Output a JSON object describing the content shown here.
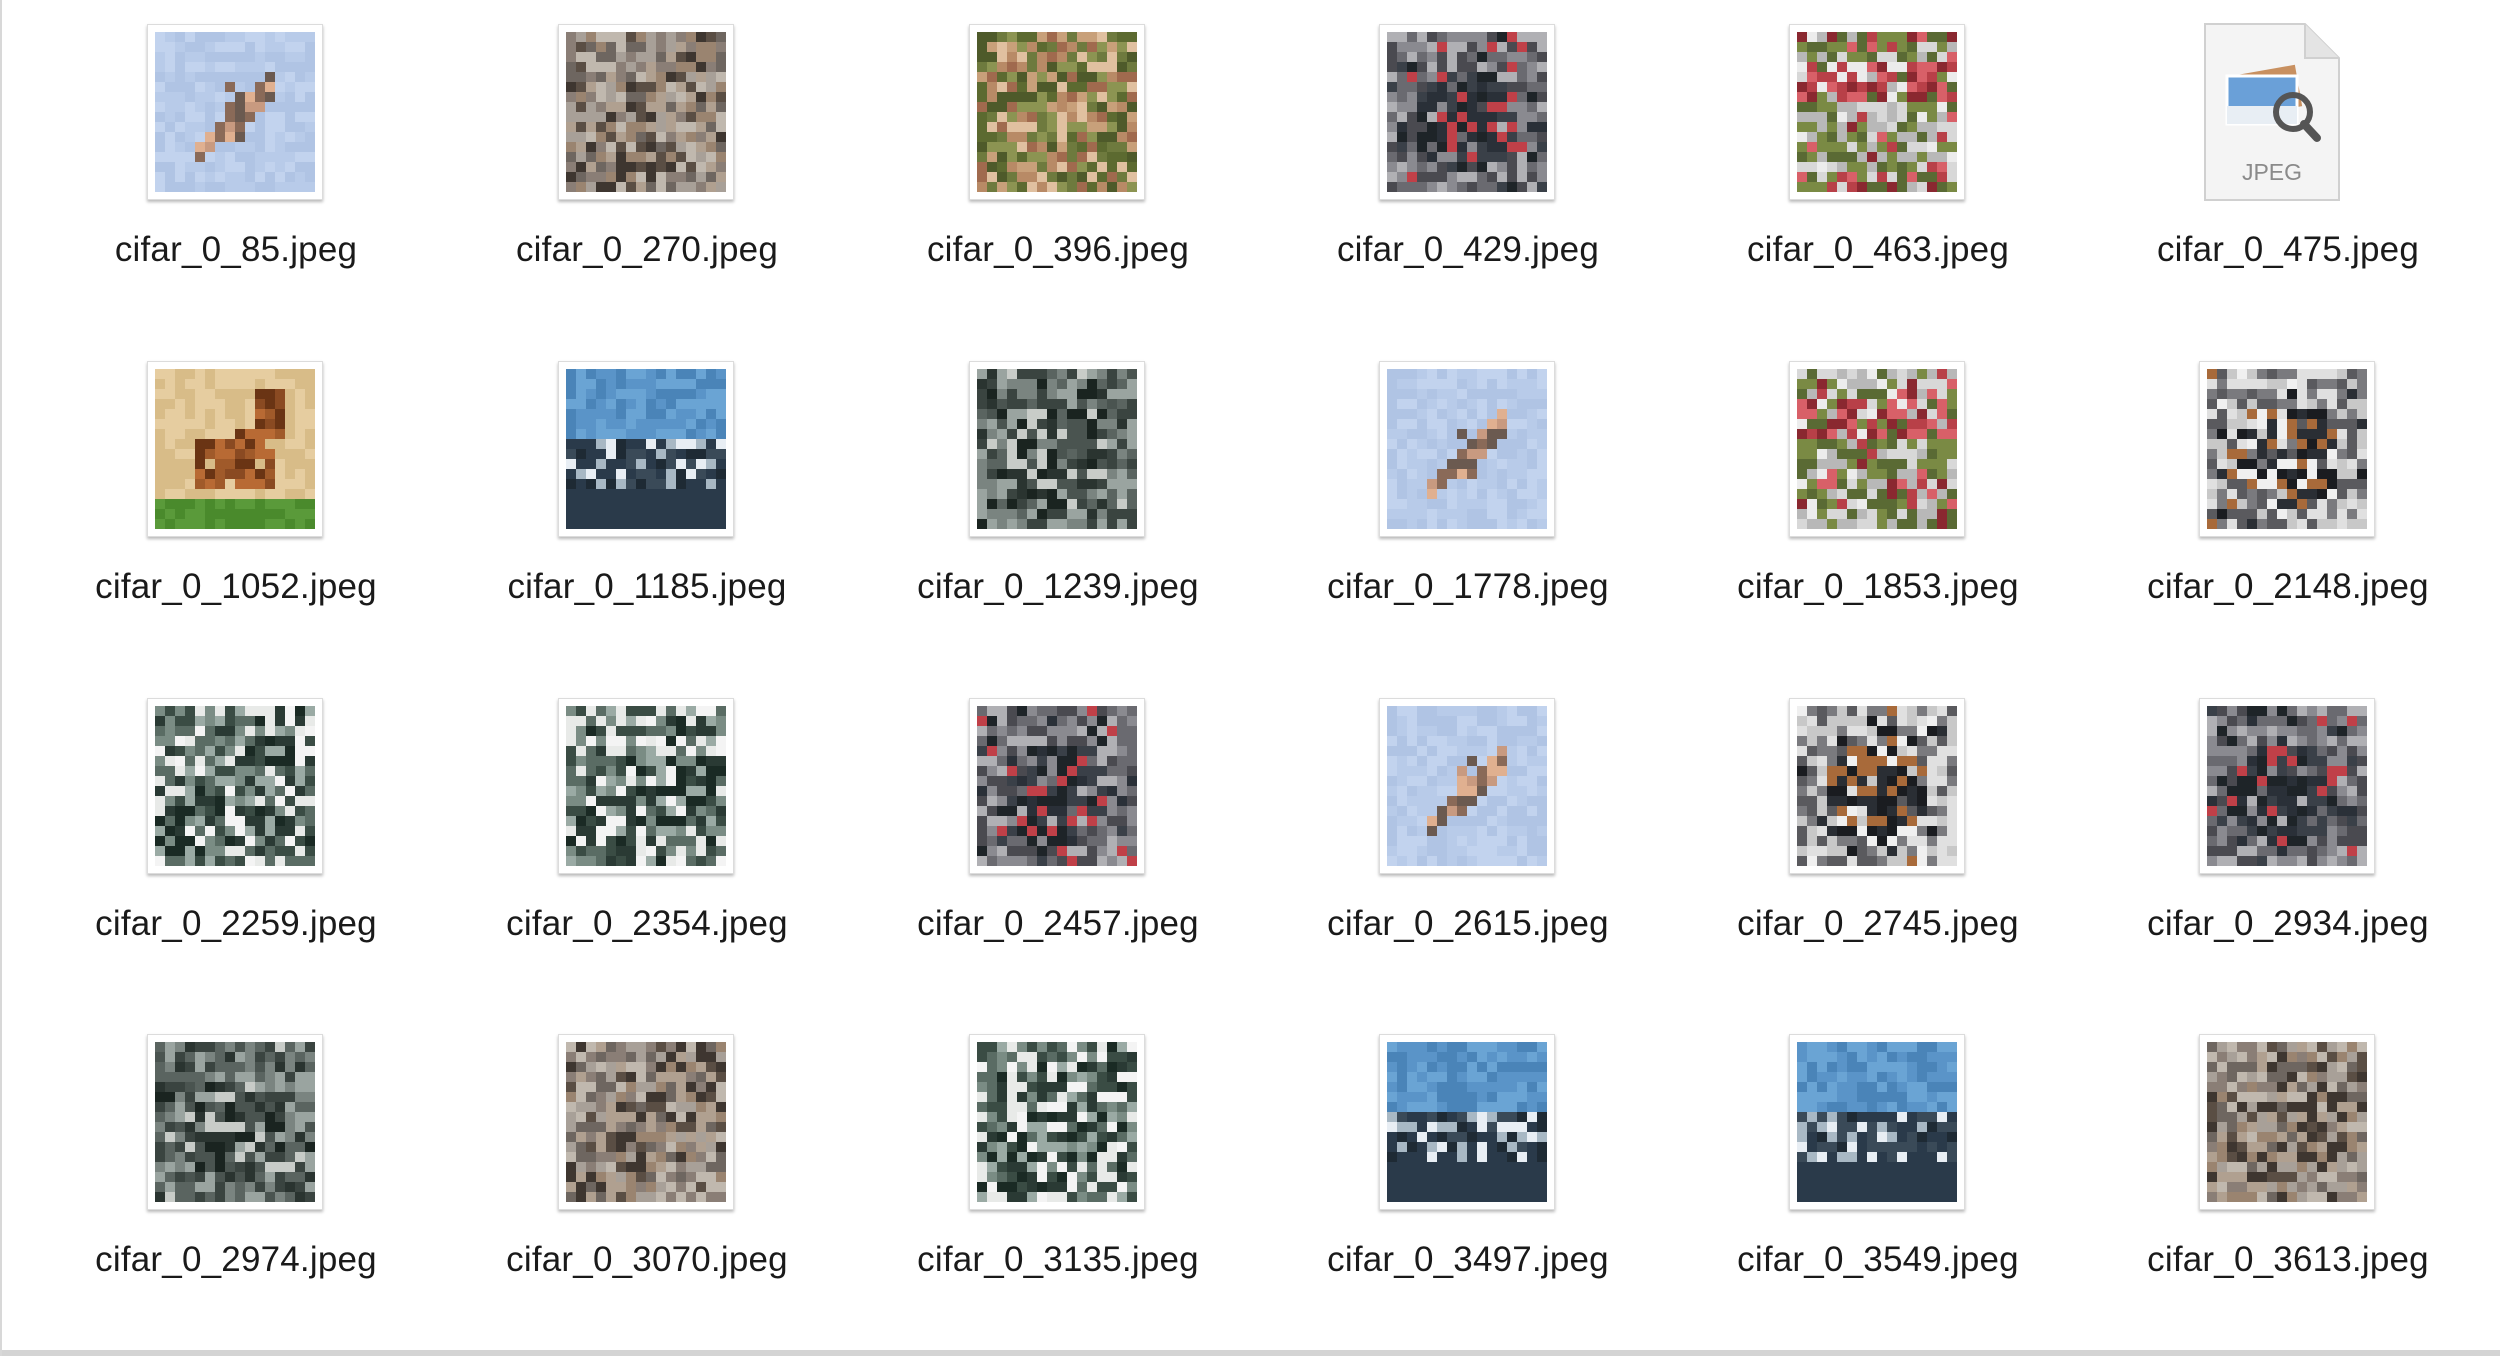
{
  "files": [
    {
      "name": "cifar_0_85.jpeg",
      "icon": "airplane-thumbnail"
    },
    {
      "name": "cifar_0_270.jpeg",
      "icon": "bird-thumbnail"
    },
    {
      "name": "cifar_0_396.jpeg",
      "icon": "foliage-thumbnail"
    },
    {
      "name": "cifar_0_429.jpeg",
      "icon": "vehicle-thumbnail"
    },
    {
      "name": "cifar_0_463.jpeg",
      "icon": "red-object-thumbnail"
    },
    {
      "name": "cifar_0_475.jpeg",
      "icon": "jpeg-document-icon",
      "icon_label": "JPEG"
    },
    {
      "name": "cifar_0_1052.jpeg",
      "icon": "horse-thumbnail"
    },
    {
      "name": "cifar_0_1185.jpeg",
      "icon": "ship-thumbnail"
    },
    {
      "name": "cifar_0_1239.jpeg",
      "icon": "truck-thumbnail"
    },
    {
      "name": "cifar_0_1778.jpeg",
      "icon": "airplane-thumbnail"
    },
    {
      "name": "cifar_0_1853.jpeg",
      "icon": "red-object-thumbnail"
    },
    {
      "name": "cifar_0_2148.jpeg",
      "icon": "car-thumbnail"
    },
    {
      "name": "cifar_0_2259.jpeg",
      "icon": "dark-object-thumbnail"
    },
    {
      "name": "cifar_0_2354.jpeg",
      "icon": "dark-object-thumbnail"
    },
    {
      "name": "cifar_0_2457.jpeg",
      "icon": "vehicle-thumbnail"
    },
    {
      "name": "cifar_0_2615.jpeg",
      "icon": "airplane-thumbnail"
    },
    {
      "name": "cifar_0_2745.jpeg",
      "icon": "car-thumbnail"
    },
    {
      "name": "cifar_0_2934.jpeg",
      "icon": "vehicle-thumbnail"
    },
    {
      "name": "cifar_0_2974.jpeg",
      "icon": "truck-thumbnail"
    },
    {
      "name": "cifar_0_3070.jpeg",
      "icon": "bird-thumbnail"
    },
    {
      "name": "cifar_0_3135.jpeg",
      "icon": "dark-object-thumbnail"
    },
    {
      "name": "cifar_0_3497.jpeg",
      "icon": "ship-thumbnail"
    },
    {
      "name": "cifar_0_3549.jpeg",
      "icon": "ship-thumbnail"
    },
    {
      "name": "cifar_0_3613.jpeg",
      "icon": "bird-thumbnail"
    }
  ],
  "colors": {
    "label_text": "#1a1a1a",
    "background": "#ffffff",
    "thumb_border": "#dcdcdc"
  }
}
